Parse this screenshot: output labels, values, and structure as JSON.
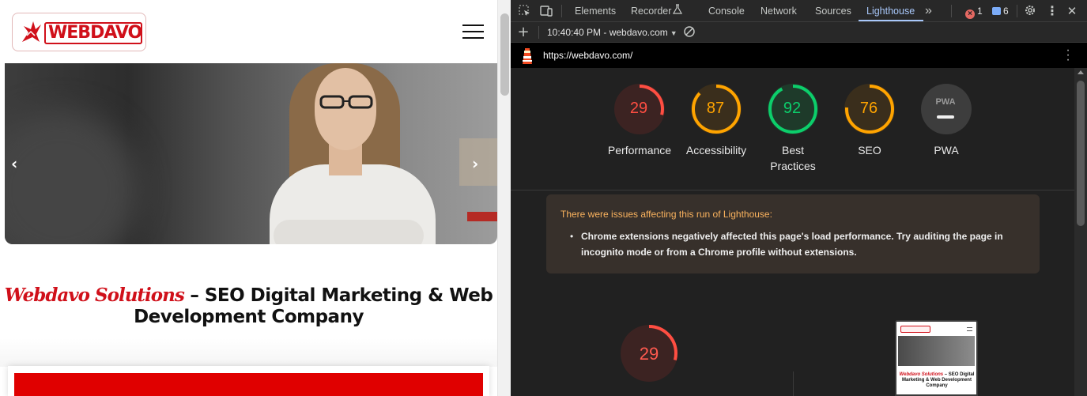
{
  "site": {
    "logo_text": "WEBDAVO",
    "title_brand": "Webdavo Solutions",
    "title_rest": " – SEO Digital Marketing & Web Development Company"
  },
  "devtools": {
    "tabs": [
      {
        "label": "Elements"
      },
      {
        "label": "Recorder"
      },
      {
        "label": "Console"
      },
      {
        "label": "Network"
      },
      {
        "label": "Sources"
      },
      {
        "label": "Lighthouse"
      }
    ],
    "active_tab": "Lighthouse",
    "more_tabs_glyph": "»",
    "errors_count": "1",
    "messages_count": "6",
    "report_selector": "10:40:40 PM - webdavo.com",
    "report_url": "https://webdavo.com/"
  },
  "scores": [
    {
      "label": "Performance",
      "value": "29",
      "score": 0.29,
      "status": "fail"
    },
    {
      "label": "Accessibility",
      "value": "87",
      "score": 0.87,
      "status": "average"
    },
    {
      "label": "Best Practices",
      "value": "92",
      "score": 0.92,
      "status": "pass"
    },
    {
      "label": "SEO",
      "value": "76",
      "score": 0.76,
      "status": "average"
    },
    {
      "label": "PWA",
      "value": "PWA",
      "score": null,
      "status": "na"
    }
  ],
  "warning": {
    "title": "There were issues affecting this run of Lighthouse:",
    "items": [
      "Chrome extensions negatively affected this page's load performance. Try auditing the page in incognito mode or from a Chrome profile without extensions."
    ]
  },
  "performance_detail": {
    "value": "29",
    "score": 0.29
  },
  "thumbnail": {
    "title_brand": "Webdavo Solutions",
    "title_rest": " – SEO Digital Marketing & Web Development Company"
  },
  "colors": {
    "fail": "#ff4e42",
    "average": "#ffa400",
    "pass": "#0cce6b",
    "brand_red": "#d0101a",
    "active_tab": "#a8c7fa"
  }
}
